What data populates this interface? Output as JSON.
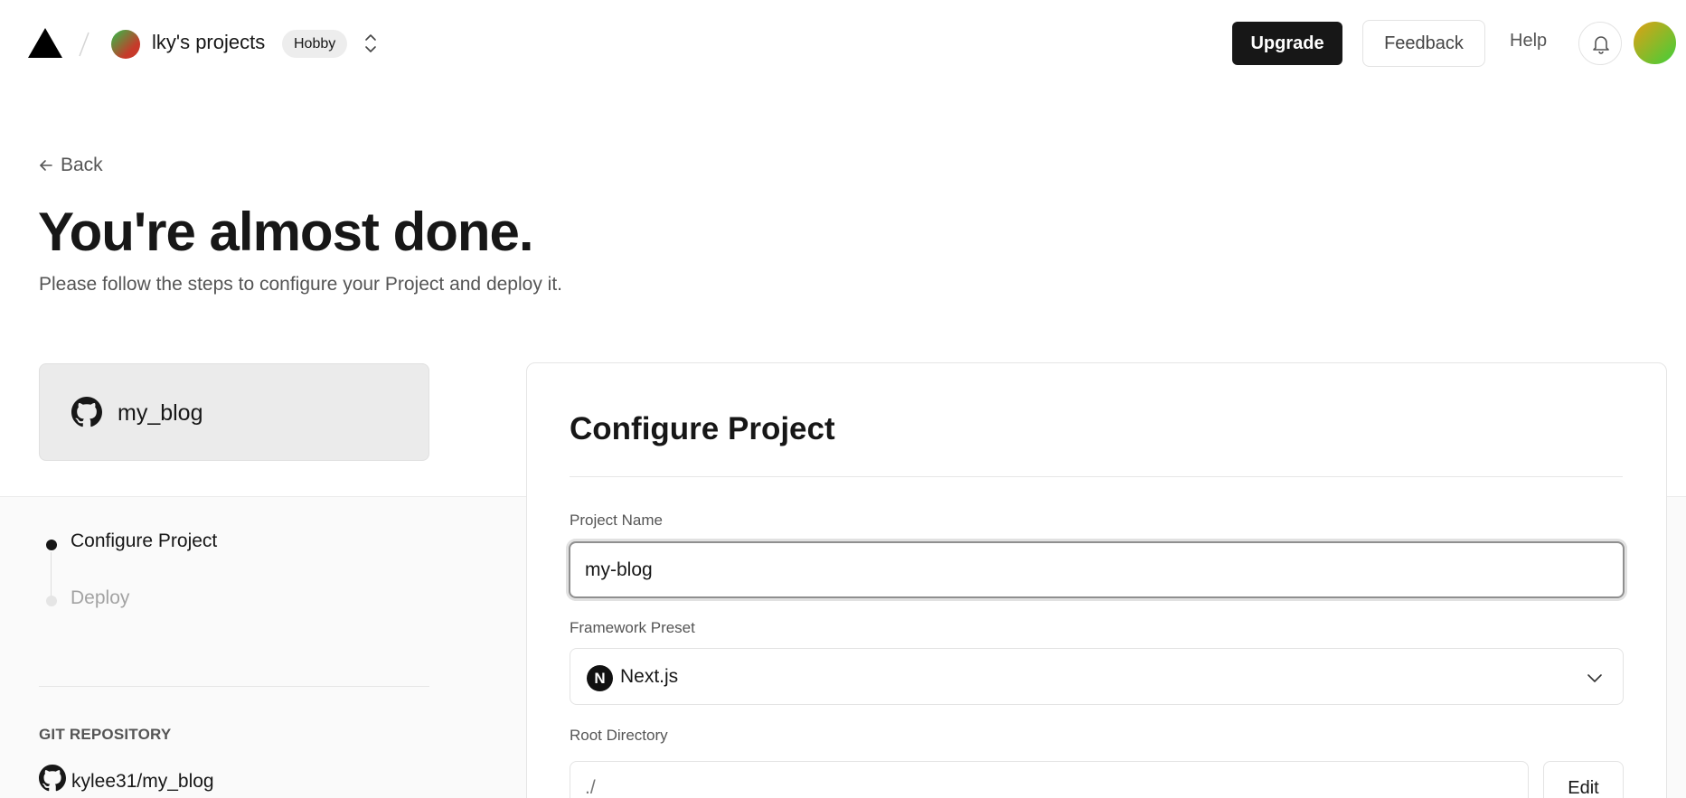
{
  "nav": {
    "logo_icon": "vercel-triangle-icon",
    "team_name": "lky's projects",
    "plan_badge": "Hobby",
    "upgrade_label": "Upgrade",
    "feedback_label": "Feedback",
    "help_label": "Help",
    "bell_icon": "bell-icon"
  },
  "header": {
    "back_label": "Back",
    "title": "You're almost done.",
    "subtitle": "Please follow the steps to configure your Project and deploy it."
  },
  "sidebar": {
    "repo_card_name": "my_blog",
    "steps": [
      {
        "label": "Configure Project",
        "state": "active"
      },
      {
        "label": "Deploy",
        "state": "pending"
      }
    ],
    "git_section_label": "GIT REPOSITORY",
    "git_repo": "kylee31/my_blog"
  },
  "config": {
    "title": "Configure Project",
    "project_name_label": "Project Name",
    "project_name_value": "my-blog",
    "framework_label": "Framework Preset",
    "framework_value": "Next.js",
    "framework_icon_letter": "N",
    "root_dir_label": "Root Directory",
    "root_dir_value": "./",
    "edit_label": "Edit"
  },
  "colors": {
    "primary": "#171717",
    "muted_text": "#555555",
    "step_pending": "#a3a3a3"
  }
}
